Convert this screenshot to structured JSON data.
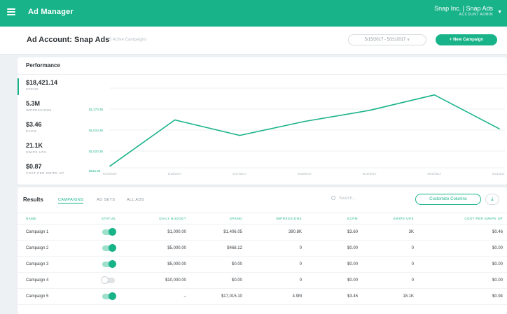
{
  "topbar": {
    "app_title": "Ad Manager",
    "org_name": "Snap Inc. | Snap Ads",
    "role": "ACCOUNT ADMIN"
  },
  "header": {
    "title": "Ad Account: Snap Ads",
    "subtitle": "5 Active Campaigns",
    "date_range": "5/15/2017 - 5/21/2017 ∨",
    "new_campaign_label": "+ New Campaign"
  },
  "performance": {
    "title": "Performance",
    "metrics": [
      {
        "value": "$18,421.14",
        "label": "SPEND"
      },
      {
        "value": "5.3M",
        "label": "IMPRESSIONS"
      },
      {
        "value": "$3.46",
        "label": "ECPM"
      },
      {
        "value": "21.1K",
        "label": "SWIPE UPS"
      },
      {
        "value": "$0.87",
        "label": "COST PER SWIPE UP"
      }
    ]
  },
  "chart_data": {
    "type": "line",
    "x": [
      "5/15/2017",
      "5/16/2017",
      "5/17/2017",
      "5/18/2017",
      "5/19/2017",
      "5/20/2017",
      "5/21/2017"
    ],
    "series": [
      {
        "values": [
          115,
          3250,
          2200,
          3150,
          3900,
          4950,
          2650
        ]
      }
    ],
    "ytick_labels": [
      "$1,373.35",
      "$1,010.35",
      "$1,023.35",
      "$615.35"
    ],
    "ylim": [
      0,
      5600
    ],
    "color": "#19b38a"
  },
  "results": {
    "title": "Results",
    "tabs": [
      "CAMPAIGNS",
      "AD SETS",
      "ALL ADS"
    ],
    "search_placeholder": "Search...",
    "customize_label": "Customize Columns",
    "download_icon": "⤓",
    "columns": [
      "NAME",
      "STATUS",
      "DAILY BUDGET",
      "SPEND",
      "IMPRESSIONS",
      "ECPM",
      "SWIPE UPS",
      "COST PER SWIPE UP"
    ],
    "rows": [
      {
        "name": "Campaign 1",
        "status": "on",
        "budget": "$1,000.00",
        "spend": "$1,406.05",
        "impressions": "390.8K",
        "ecpm": "$3.60",
        "swipe_ups": "3K",
        "cpsu": "$0.46"
      },
      {
        "name": "Campaign 2",
        "status": "on",
        "budget": "$5,000.00",
        "spend": "$468.12",
        "impressions": "0",
        "ecpm": "$0.00",
        "swipe_ups": "0",
        "cpsu": "$0.00"
      },
      {
        "name": "Campaign 3",
        "status": "on",
        "budget": "$5,000.00",
        "spend": "$0.00",
        "impressions": "0",
        "ecpm": "$0.00",
        "swipe_ups": "0",
        "cpsu": "$0.00"
      },
      {
        "name": "Campaign 4",
        "status": "off",
        "budget": "$10,000.00",
        "spend": "$0.00",
        "impressions": "0",
        "ecpm": "$0.00",
        "swipe_ups": "0",
        "cpsu": "$0.00"
      },
      {
        "name": "Campaign 5",
        "status": "on",
        "budget": "–",
        "spend": "$17,015.10",
        "impressions": "4.9M",
        "ecpm": "$3.45",
        "swipe_ups": "18.1K",
        "cpsu": "$0.94"
      }
    ]
  }
}
